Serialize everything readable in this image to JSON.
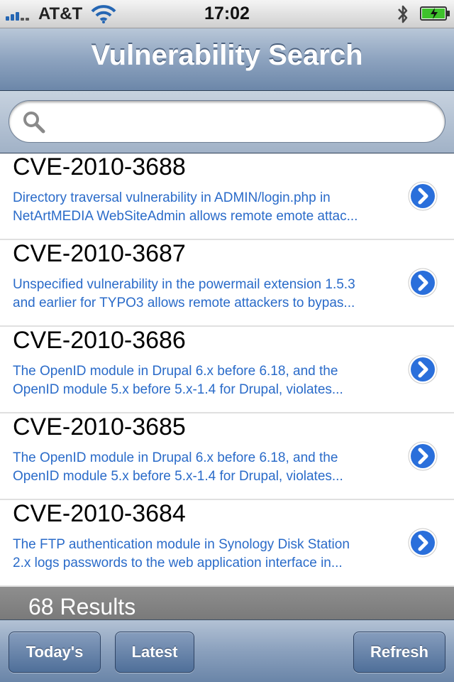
{
  "status_bar": {
    "carrier": "AT&T",
    "time": "17:02"
  },
  "nav": {
    "title": "Vulnerability Search"
  },
  "search": {
    "value": "",
    "placeholder": ""
  },
  "entries": [
    {
      "id": "CVE-2010-3688",
      "description": "Directory traversal vulnerability in ADMIN/login.php in\nNetArtMEDIA WebSiteAdmin allows remote emote attac..."
    },
    {
      "id": "CVE-2010-3687",
      "description": "Unspecified vulnerability in the powermail extension 1.5.3\nand earlier for TYPO3 allows remote attackers to bypas..."
    },
    {
      "id": "CVE-2010-3686",
      "description": "The OpenID module in Drupal 6.x before 6.18, and the\nOpenID module 5.x before 5.x-1.4 for Drupal, violates..."
    },
    {
      "id": "CVE-2010-3685",
      "description": "The OpenID module in Drupal 6.x before 6.18, and the\nOpenID module 5.x before 5.x-1.4 for Drupal, violates..."
    },
    {
      "id": "CVE-2010-3684",
      "description": "The FTP authentication module in Synology Disk Station\n2.x logs passwords to the web application interface in..."
    }
  ],
  "results_label": "68 Results",
  "toolbar": {
    "todays_label": "Today's",
    "latest_label": "Latest",
    "refresh_label": "Refresh"
  },
  "icons": {
    "signal": "signal-bars-icon",
    "wifi": "wifi-icon",
    "bluetooth": "bluetooth-icon",
    "battery": "battery-charging-icon",
    "search": "magnifier-icon",
    "disclosure": "detail-disclosure-icon"
  },
  "colors": {
    "link_blue": "#2a6bc9",
    "battery_green": "#3ec22c",
    "nav_blue": "#6c87a9"
  }
}
